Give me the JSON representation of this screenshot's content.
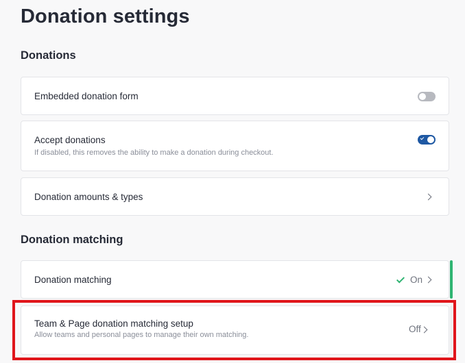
{
  "page": {
    "title": "Donation settings"
  },
  "sections": {
    "donations": {
      "title": "Donations"
    },
    "matching": {
      "title": "Donation matching"
    }
  },
  "cards": {
    "embedded_form": {
      "title": "Embedded donation form",
      "toggle_state": "off"
    },
    "accept_donations": {
      "title": "Accept donations",
      "description": "If disabled, this removes the ability to make a donation during checkout.",
      "toggle_state": "on"
    },
    "amounts_types": {
      "title": "Donation amounts & types"
    },
    "donation_matching": {
      "title": "Donation matching",
      "status": "On"
    },
    "team_page_matching": {
      "title": "Team & Page donation matching setup",
      "description": "Allow teams and personal pages to manage their own matching.",
      "status": "Off"
    }
  },
  "colors": {
    "toggle_on": "#1e58a3",
    "toggle_off": "#b7b9bf",
    "status_check": "#2fb472",
    "accent_active": "#2fb472",
    "accent_inactive": "#eeeeef",
    "highlight": "#e0151b"
  },
  "icons": {
    "toggle_check": "check-icon",
    "chevron": "chevron-right-icon",
    "status_on": "check-icon"
  }
}
